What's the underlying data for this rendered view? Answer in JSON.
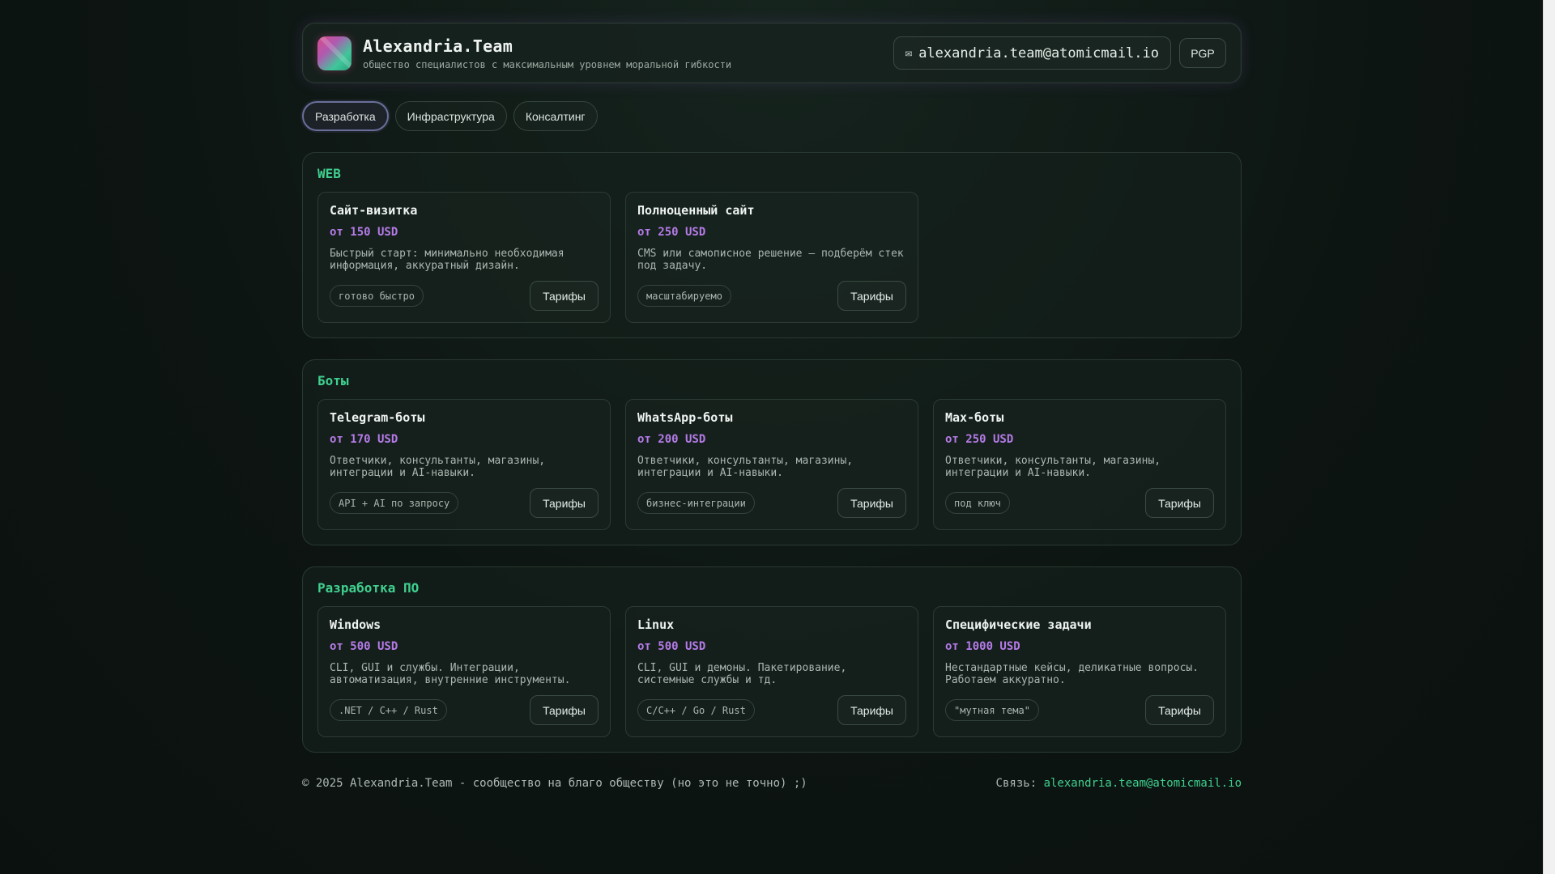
{
  "header": {
    "title": "Alexandria.Team",
    "subtitle": "общество специалистов с максимальным уровнем моральной гибкости",
    "email_icon": "✉",
    "email": "alexandria.team@atomicmail.io",
    "pgp_label": "PGP"
  },
  "tabs": [
    {
      "label": "Разработка",
      "active": true
    },
    {
      "label": "Инфраструктура",
      "active": false
    },
    {
      "label": "Консалтинг",
      "active": false
    }
  ],
  "sections": [
    {
      "title": "WEB",
      "cards": [
        {
          "title": "Сайт-визитка",
          "price": "от 150 USD",
          "desc1": "Быстрый старт: минимально необходимая",
          "desc2": "информация, аккуратный дизайн.",
          "tag": "готово быстро",
          "button": "Тарифы"
        },
        {
          "title": "Полноценный сайт",
          "price": "от 250 USD",
          "desc1": "CMS или самописное решение — подберём стек",
          "desc2": "под задачу.",
          "tag": "масштабируемо",
          "button": "Тарифы"
        }
      ]
    },
    {
      "title": "Боты",
      "cards": [
        {
          "title": "Telegram-боты",
          "price": "от 170 USD",
          "desc1": "Ответчики, консультанты, магазины,",
          "desc2": "интеграции и AI-навыки.",
          "tag": "API + AI по запросу",
          "button": "Тарифы"
        },
        {
          "title": "WhatsApp-боты",
          "price": "от 200 USD",
          "desc1": "Ответчики, консультанты, магазины,",
          "desc2": "интеграции и AI-навыки.",
          "tag": "бизнес-интеграции",
          "button": "Тарифы"
        },
        {
          "title": "Max-боты",
          "price": "от 250 USD",
          "desc1": "Ответчики, консультанты, магазины,",
          "desc2": "интеграции и AI-навыки.",
          "tag": "под ключ",
          "button": "Тарифы"
        }
      ]
    },
    {
      "title": "Разработка ПО",
      "cards": [
        {
          "title": "Windows",
          "price": "от 500 USD",
          "desc1": "CLI, GUI и службы. Интеграции,",
          "desc2": "автоматизация, внутренние инструменты.",
          "tag": ".NET / C++ / Rust",
          "button": "Тарифы"
        },
        {
          "title": "Linux",
          "price": "от 500 USD",
          "desc1": "CLI, GUI и демоны. Пакетирование,",
          "desc2": "системные службы и тд.",
          "tag": "C/C++ / Go / Rust",
          "button": "Тарифы"
        },
        {
          "title": "Специфические задачи",
          "price": "от 1000 USD",
          "desc1": "Нестандартные кейсы, деликатные вопросы.",
          "desc2": "Работаем аккуратно.",
          "tag": "\"мутная тема\"",
          "button": "Тарифы"
        }
      ]
    }
  ],
  "footer": {
    "copyright": "© 2025 Alexandria.Team - сообщество на благо обществу (но это не точно) ;)",
    "contact_label": "Связь:",
    "contact_email": "alexandria.team@atomicmail.io"
  },
  "colors": {
    "accent_green": "#3fd08f",
    "price_purple": "#b57be8",
    "background": "#0d1512"
  }
}
